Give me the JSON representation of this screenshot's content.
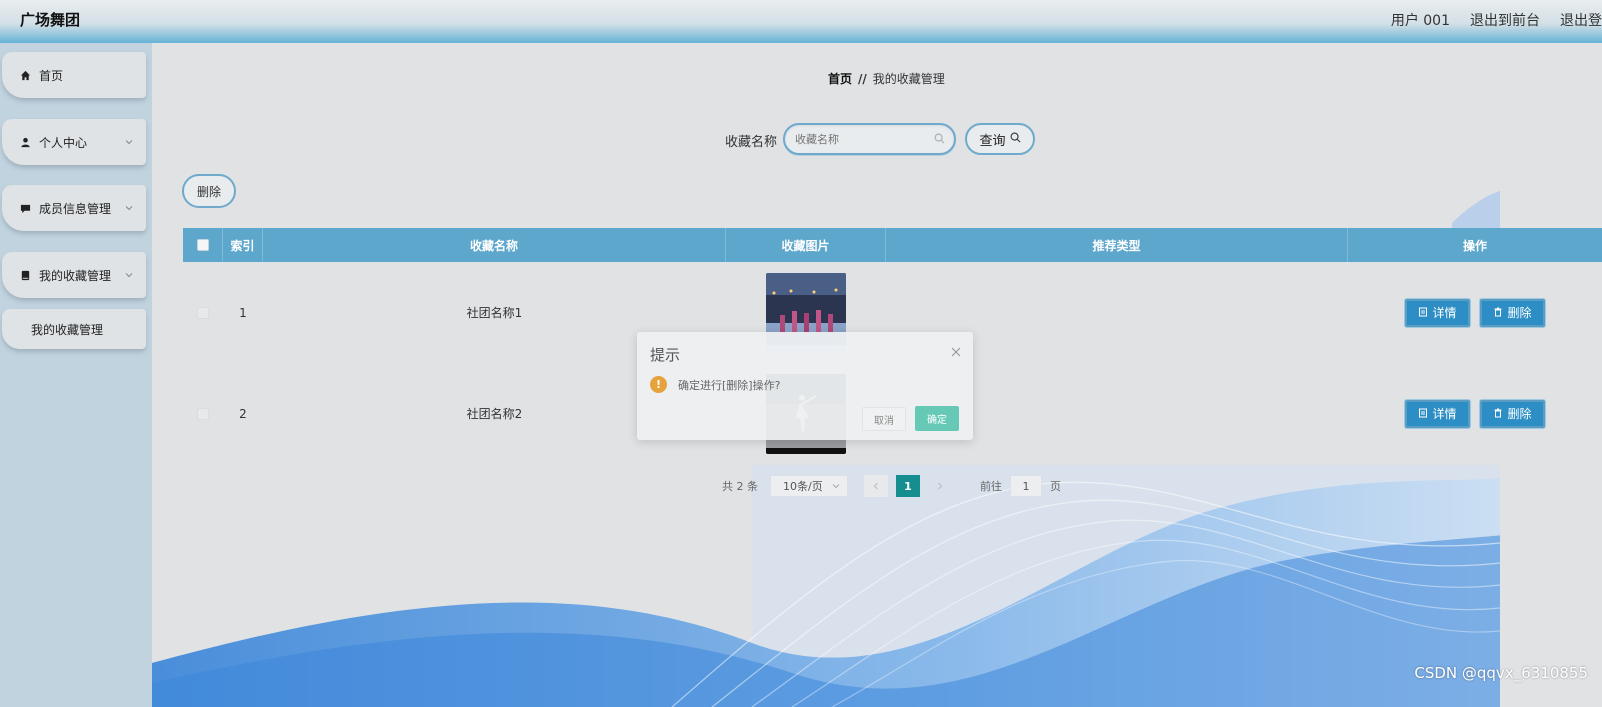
{
  "header": {
    "brand": "广场舞团",
    "user": "用户 001",
    "to_front": "退出到前台",
    "logout": "退出登"
  },
  "sidebar": {
    "items": [
      {
        "label": "首页",
        "icon": "home-icon"
      },
      {
        "label": "个人中心",
        "icon": "user-icon"
      },
      {
        "label": "成员信息管理",
        "icon": "message-icon"
      },
      {
        "label": "我的收藏管理",
        "icon": "bookmark-icon"
      }
    ],
    "submenu": {
      "label": "我的收藏管理"
    }
  },
  "breadcrumb": {
    "home": "首页",
    "separator": "//",
    "current": "我的收藏管理"
  },
  "search": {
    "label": "收藏名称",
    "placeholder": "收藏名称",
    "button": "查询"
  },
  "toolbar": {
    "delete_label": "删除"
  },
  "table": {
    "columns": [
      "索引",
      "收藏名称",
      "收藏图片",
      "推荐类型",
      "操作"
    ],
    "rows": [
      {
        "index": "1",
        "name": "社团名称1",
        "type": ""
      },
      {
        "index": "2",
        "name": "社团名称2",
        "type": ""
      }
    ],
    "detail_label": "详情",
    "delete_label": "删除"
  },
  "pagination": {
    "total": "共 2 条",
    "page_size": "10条/页",
    "current_page": "1",
    "goto_label": "前往",
    "goto_value": "1",
    "page_unit": "页"
  },
  "dialog": {
    "title": "提示",
    "message": "确定进行[删除]操作?",
    "cancel": "取消",
    "confirm": "确定"
  },
  "watermark": "CSDN @qqvx_6310855",
  "colors": {
    "header_accent": "#66b2d6",
    "table_header": "#5ea7cc",
    "op_button": "#2c8ec4",
    "page_active": "#168e8f",
    "dialog_confirm": "#66c9b5",
    "warning": "#e6a23c"
  }
}
